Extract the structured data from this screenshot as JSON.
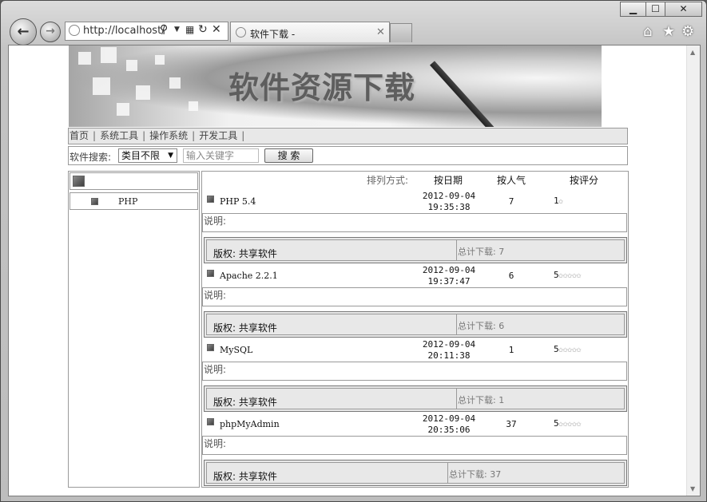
{
  "browser": {
    "address_text": "http://localhost/",
    "tab_title": "软件下载 -",
    "window_controls": {
      "minimize": "▁",
      "maximize": "☐",
      "close": "✕"
    },
    "toolbar_icons": [
      "home-icon",
      "star-icon",
      "gear-icon"
    ]
  },
  "page": {
    "banner_title": "软件资源下载",
    "menu": [
      "首页",
      "系统工具",
      "操作系统",
      "开发工具"
    ],
    "menu_separator": "|",
    "search": {
      "label": "软件搜索:",
      "category_selected": "类目不限",
      "keyword_placeholder": "输入关键字",
      "button_label": "搜 索"
    },
    "sidebar": {
      "items": [
        {
          "label": "PHP"
        }
      ]
    },
    "sort": {
      "label": "排列方式:",
      "by_date": "按日期",
      "by_popularity": "按人气",
      "by_rating": "按评分"
    },
    "labels": {
      "description": "说明:",
      "copyright": "版权: 共享软件",
      "total_downloads": "总计下载:"
    },
    "entries": [
      {
        "name": "PHP 5.4",
        "date": "2012-09-04",
        "time": "19:35:38",
        "popularity": "7",
        "rating": "1",
        "stars": 1,
        "downloads": "7"
      },
      {
        "name": "Apache 2.2.1",
        "date": "2012-09-04",
        "time": "19:37:47",
        "popularity": "6",
        "rating": "5",
        "stars": 5,
        "downloads": "6"
      },
      {
        "name": "MySQL",
        "date": "2012-09-04",
        "time": "20:11:38",
        "popularity": "1",
        "rating": "5",
        "stars": 5,
        "downloads": "1"
      },
      {
        "name": "phpMyAdmin",
        "date": "2012-09-04",
        "time": "20:35:06",
        "popularity": "37",
        "rating": "5",
        "stars": 5,
        "downloads": "37"
      }
    ]
  }
}
